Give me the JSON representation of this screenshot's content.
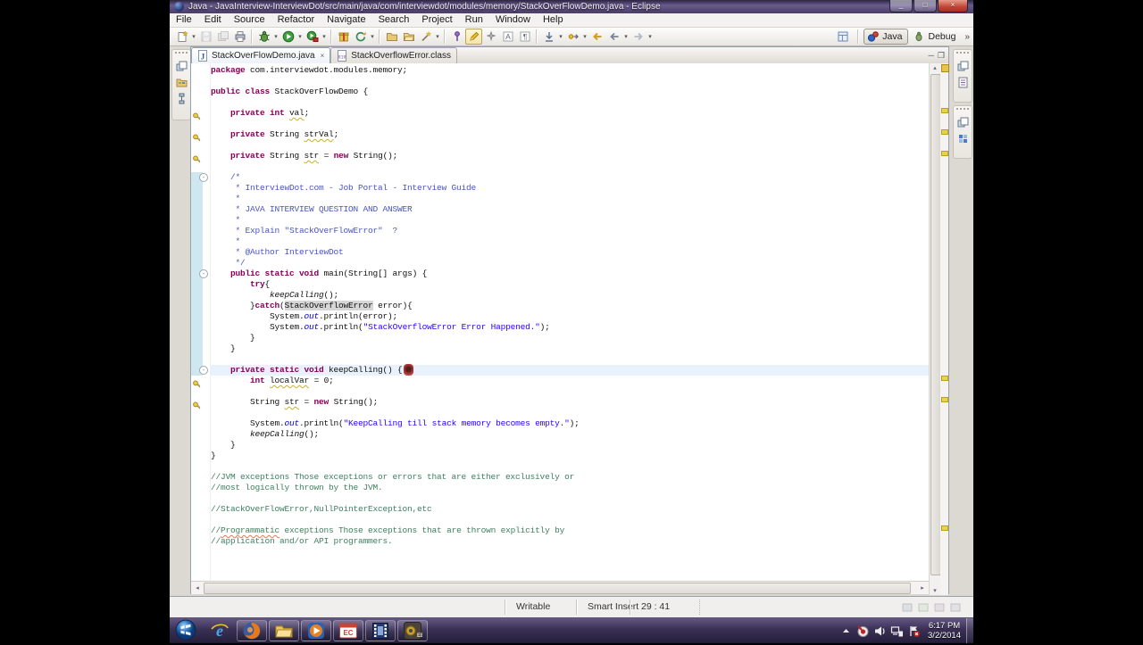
{
  "window": {
    "title": "Java - JavaInterview-InterviewDot/src/main/java/com/interviewdot/modules/memory/StackOverFlowDemo.java - Eclipse",
    "minimize": "_",
    "maximize": "□",
    "close": "×"
  },
  "menu": {
    "items": [
      "File",
      "Edit",
      "Source",
      "Refactor",
      "Navigate",
      "Search",
      "Project",
      "Run",
      "Window",
      "Help"
    ]
  },
  "toolbar": {
    "groups": [
      [
        {
          "name": "new-wizard",
          "icon": "newwiz",
          "dd": true
        },
        {
          "name": "save",
          "icon": "save",
          "disabled": true
        },
        {
          "name": "save-all",
          "icon": "saveall",
          "disabled": true
        },
        {
          "name": "print",
          "icon": "print"
        }
      ],
      [
        {
          "name": "debug",
          "icon": "debug",
          "dd": true
        },
        {
          "name": "run",
          "icon": "run",
          "dd": true
        },
        {
          "name": "run-external-tools",
          "icon": "runext",
          "dd": true
        }
      ],
      [
        {
          "name": "new-java-project",
          "icon": "gift"
        },
        {
          "name": "refresh",
          "icon": "refresh",
          "dd": true
        }
      ],
      [
        {
          "name": "open-folder",
          "icon": "folder1"
        },
        {
          "name": "open-resource",
          "icon": "folder2"
        },
        {
          "name": "quick-fix-wand",
          "icon": "wand",
          "dd": true
        }
      ],
      [
        {
          "name": "toggle-pin",
          "icon": "pin"
        },
        {
          "name": "mark-occurrences",
          "icon": "pencil",
          "pressed": true
        },
        {
          "name": "annotations",
          "icon": "spark"
        },
        {
          "name": "show-source",
          "icon": "abox"
        },
        {
          "name": "show-whitespace",
          "icon": "pilcrow"
        }
      ],
      [
        {
          "name": "last-edit-location",
          "icon": "down",
          "dd": true
        },
        {
          "name": "next-annotation",
          "icon": "nav",
          "dd": true
        },
        {
          "name": "back-to-last-edit",
          "icon": "backyellow"
        },
        {
          "name": "back-history",
          "icon": "left",
          "dd": true
        },
        {
          "name": "forward-history",
          "icon": "right",
          "dd": true
        }
      ]
    ],
    "perspectives": {
      "java": "Java",
      "debug": "Debug",
      "more": "»"
    }
  },
  "editor": {
    "tabs": [
      {
        "label": "StackOverFlowDemo.java",
        "icon": "jfile",
        "active": true,
        "close": "×"
      },
      {
        "label": "StackOverflowError.class",
        "icon": "classfile",
        "active": false
      }
    ],
    "code": {
      "lines": [
        {
          "s": [
            [
              "kw",
              "package"
            ],
            [
              "pl",
              " com.interviewdot.modules.memory;"
            ]
          ]
        },
        {
          "s": []
        },
        {
          "s": [
            [
              "kw",
              "public class"
            ],
            [
              "pl",
              " StackOverFlowDemo {"
            ]
          ]
        },
        {
          "s": []
        },
        {
          "w": 1,
          "s": [
            [
              "pl",
              "    "
            ],
            [
              "kw",
              "private int"
            ],
            [
              "pl",
              " "
            ],
            [
              "uv",
              "val"
            ],
            [
              "pl",
              ";"
            ]
          ]
        },
        {
          "s": []
        },
        {
          "w": 1,
          "s": [
            [
              "pl",
              "    "
            ],
            [
              "kw",
              "private"
            ],
            [
              "pl",
              " String "
            ],
            [
              "uv",
              "strVal"
            ],
            [
              "pl",
              ";"
            ]
          ]
        },
        {
          "s": []
        },
        {
          "w": 1,
          "s": [
            [
              "pl",
              "    "
            ],
            [
              "kw",
              "private"
            ],
            [
              "pl",
              " String "
            ],
            [
              "uv",
              "str"
            ],
            [
              "pl",
              " = "
            ],
            [
              "kw",
              "new"
            ],
            [
              "pl",
              " String();"
            ]
          ]
        },
        {
          "s": []
        },
        {
          "f": 1,
          "s": [
            [
              "pl",
              "    "
            ],
            [
              "dc",
              "/*"
            ]
          ]
        },
        {
          "s": [
            [
              "dc",
              "     * InterviewDot.com - Job Portal - Interview Guide"
            ]
          ]
        },
        {
          "s": [
            [
              "dc",
              "     *"
            ]
          ]
        },
        {
          "s": [
            [
              "dc",
              "     * JAVA INTERVIEW QUESTION AND ANSWER"
            ]
          ]
        },
        {
          "s": [
            [
              "dc",
              "     *"
            ]
          ]
        },
        {
          "s": [
            [
              "dc",
              "     * Explain \"StackOverFlowError\"  ?"
            ]
          ]
        },
        {
          "s": [
            [
              "dc",
              "     *"
            ]
          ]
        },
        {
          "s": [
            [
              "dc",
              "     * @Author InterviewDot"
            ]
          ]
        },
        {
          "s": [
            [
              "dc",
              "     */"
            ]
          ]
        },
        {
          "f": 1,
          "s": [
            [
              "pl",
              "    "
            ],
            [
              "kw",
              "public static void"
            ],
            [
              "pl",
              " main(String[] args) {"
            ]
          ]
        },
        {
          "s": [
            [
              "pl",
              "        "
            ],
            [
              "kw",
              "try"
            ],
            [
              "pl",
              "{"
            ]
          ]
        },
        {
          "s": [
            [
              "pl",
              "            "
            ],
            [
              "mi",
              "keepCalling"
            ],
            [
              "pl",
              "();"
            ]
          ]
        },
        {
          "s": [
            [
              "pl",
              "        }"
            ],
            [
              "kw",
              "catch"
            ],
            [
              "pl",
              "("
            ],
            [
              "occ",
              "StackOverflowError"
            ],
            [
              "pl",
              " error){"
            ]
          ]
        },
        {
          "s": [
            [
              "pl",
              "            System."
            ],
            [
              "sf",
              "out"
            ],
            [
              "pl",
              ".println(error);"
            ]
          ]
        },
        {
          "s": [
            [
              "pl",
              "            System."
            ],
            [
              "sf",
              "out"
            ],
            [
              "pl",
              ".println("
            ],
            [
              "st",
              "\"StackOverflowError Error Happened.\""
            ],
            [
              "pl",
              ");"
            ]
          ]
        },
        {
          "s": [
            [
              "pl",
              "        }"
            ]
          ]
        },
        {
          "s": [
            [
              "pl",
              "    }"
            ]
          ]
        },
        {
          "s": []
        },
        {
          "f": 1,
          "c": 1,
          "s": [
            [
              "pl",
              "    "
            ],
            [
              "kw",
              "private static void"
            ],
            [
              "pl",
              " keepCalling() {"
            ]
          ]
        },
        {
          "w": 1,
          "s": [
            [
              "pl",
              "        "
            ],
            [
              "kw",
              "int"
            ],
            [
              "pl",
              " "
            ],
            [
              "uv",
              "localVar"
            ],
            [
              "pl",
              " = 0;"
            ]
          ]
        },
        {
          "s": []
        },
        {
          "w": 1,
          "s": [
            [
              "pl",
              "        String "
            ],
            [
              "uv",
              "str"
            ],
            [
              "pl",
              " = "
            ],
            [
              "kw",
              "new"
            ],
            [
              "pl",
              " String();"
            ]
          ]
        },
        {
          "s": []
        },
        {
          "s": [
            [
              "pl",
              "        System."
            ],
            [
              "sf",
              "out"
            ],
            [
              "pl",
              ".println("
            ],
            [
              "st",
              "\"KeepCalling till stack memory becomes empty.\""
            ],
            [
              "pl",
              ");"
            ]
          ]
        },
        {
          "s": [
            [
              "pl",
              "        "
            ],
            [
              "mi",
              "keepCalling"
            ],
            [
              "pl",
              "();"
            ]
          ]
        },
        {
          "s": [
            [
              "pl",
              "    }"
            ]
          ]
        },
        {
          "s": [
            [
              "pl",
              "}"
            ]
          ]
        },
        {
          "s": []
        },
        {
          "s": [
            [
              "cm",
              "//JVM exceptions Those exceptions or errors that are either exclusively or"
            ]
          ]
        },
        {
          "s": [
            [
              "cm",
              "//most logically thrown by the JVM."
            ]
          ]
        },
        {
          "s": []
        },
        {
          "s": [
            [
              "cm",
              "//StackOverFlowError,NullPointerException,etc"
            ]
          ]
        },
        {
          "s": []
        },
        {
          "s": [
            [
              "cm",
              "//"
            ],
            [
              "cm sp",
              "Programmatic"
            ],
            [
              "cm",
              " exceptions Those exceptions that are thrown explicitly by"
            ]
          ]
        },
        {
          "s": [
            [
              "cm",
              "//application and/or API programmers."
            ]
          ]
        }
      ]
    },
    "overview_marks": [
      4,
      6,
      8,
      29,
      31,
      43
    ],
    "colors": {
      "keyword": "#7f0055",
      "string": "#2a00ff",
      "comment": "#3f7f5f",
      "doc_comment": "#4a55bf",
      "static_field": "#0000c0",
      "occurrence_bg": "#d6d6d6",
      "current_line": "#e9f2fc"
    }
  },
  "statusbar": {
    "writable": "Writable",
    "insert_mode": "Smart Insert",
    "caret_position": "29 : 41"
  },
  "taskbar": {
    "apps": [
      {
        "name": "internet-explorer",
        "icon": "ie",
        "open": false
      },
      {
        "name": "firefox",
        "icon": "firefox",
        "open": true
      },
      {
        "name": "windows-explorer",
        "icon": "explorer",
        "open": true
      },
      {
        "name": "media-player",
        "icon": "wmp",
        "open": true
      },
      {
        "name": "presentation-app",
        "icon": "ec",
        "open": true
      },
      {
        "name": "movie-maker",
        "icon": "movie",
        "open": true
      },
      {
        "name": "eclipse-java-ee",
        "icon": "eclipseee",
        "open": true
      }
    ],
    "tray_icons": [
      {
        "name": "show-hidden-icons",
        "icon": "uparrow"
      },
      {
        "name": "screen-recorder",
        "icon": "record"
      },
      {
        "name": "volume",
        "icon": "volume"
      },
      {
        "name": "network",
        "icon": "network"
      },
      {
        "name": "action-center",
        "icon": "flag"
      }
    ],
    "clock": {
      "time": "6:17 PM",
      "date": "3/2/2014"
    }
  }
}
